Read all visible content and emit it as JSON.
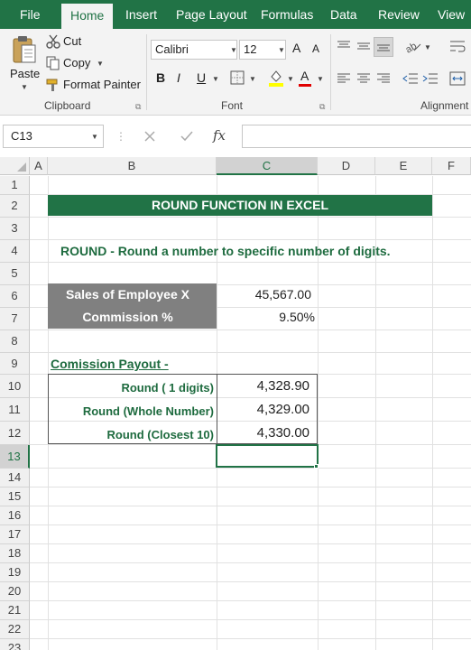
{
  "ribbon_tabs": [
    "File",
    "Home",
    "Insert",
    "Page Layout",
    "Formulas",
    "Data",
    "Review",
    "View"
  ],
  "active_tab": "Home",
  "clipboard": {
    "paste_label": "Paste",
    "cut_label": "Cut",
    "copy_label": "Copy",
    "format_painter_label": "Format Painter",
    "group_label": "Clipboard"
  },
  "font": {
    "name": "Calibri",
    "size": "12",
    "bold": "B",
    "italic": "I",
    "underline": "U",
    "grow": "A",
    "shrink": "A",
    "font_color": "A",
    "group_label": "Font"
  },
  "alignment": {
    "group_label": "Alignment"
  },
  "formula_bar": {
    "name_box": "C13",
    "fx": "fx",
    "formula": ""
  },
  "columns": [
    "A",
    "B",
    "C",
    "D",
    "E",
    "F"
  ],
  "rows": [
    "1",
    "2",
    "3",
    "4",
    "5",
    "6",
    "7",
    "8",
    "9",
    "10",
    "11",
    "12",
    "13",
    "14",
    "15",
    "16",
    "17",
    "18",
    "19",
    "20",
    "21",
    "22",
    "23"
  ],
  "selected_cell": {
    "column": "C",
    "row": "13"
  },
  "sheet": {
    "title": "ROUND FUNCTION IN EXCEL",
    "subtitle": "ROUND - Round a number to specific number of digits.",
    "sales_label": "Sales of Employee X",
    "sales_value": "45,567.00",
    "commission_label": "Commission %",
    "commission_value": "9.50%",
    "payout_heading": "Comission Payout -",
    "payouts": [
      {
        "label": "Round ( 1 digits)",
        "value": "4,328.90"
      },
      {
        "label": "Round (Whole Number)",
        "value": "4,329.00"
      },
      {
        "label": "Round (Closest 10)",
        "value": "4,330.00"
      }
    ]
  },
  "colors": {
    "excel_green": "#217346",
    "label_gray": "#808080",
    "heading_green": "#1e6b3f"
  }
}
